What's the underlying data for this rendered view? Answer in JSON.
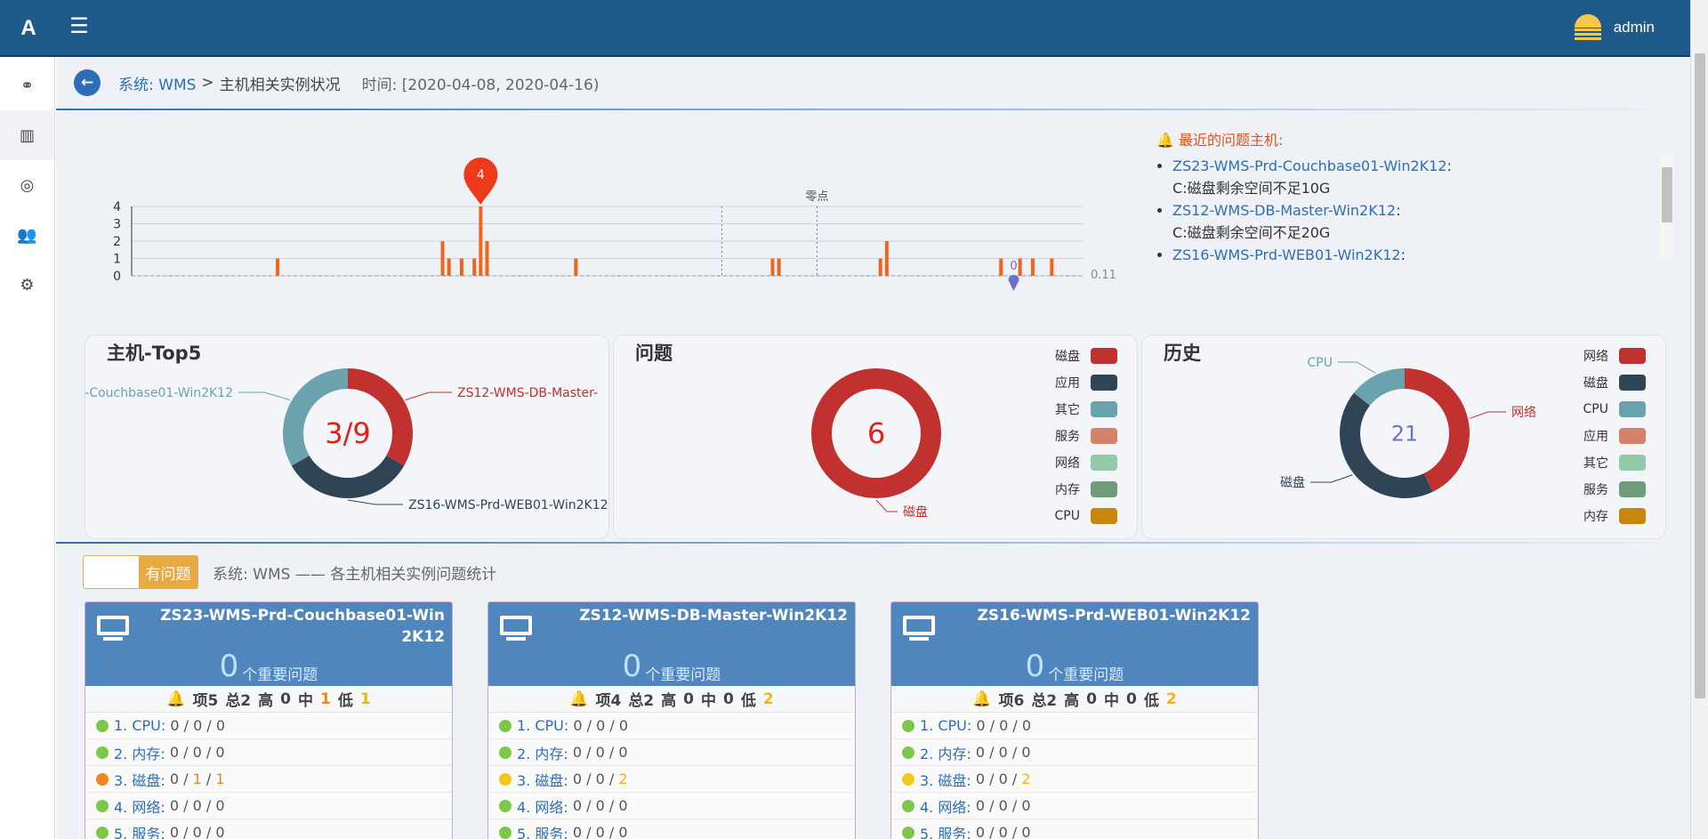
{
  "app": {
    "logo": "A",
    "menu_icon": "hamburger-icon",
    "user": "admin"
  },
  "sidebar": {
    "items": [
      {
        "icon": "link-icon",
        "glyph": "⚭"
      },
      {
        "icon": "bar-chart-icon",
        "glyph": "▥"
      },
      {
        "icon": "lifebuoy-icon",
        "glyph": "◎"
      },
      {
        "icon": "users-icon",
        "glyph": "👥"
      },
      {
        "icon": "gear-icon",
        "glyph": "⚙"
      }
    ]
  },
  "breadcrumb": {
    "system": "系统: WMS",
    "sep": ">",
    "page": "主机相关实例状况",
    "time": "时间: [2020-04-08, 2020-04-16)"
  },
  "chart_data": [
    {
      "type": "bar",
      "x": [
        23,
        49,
        50,
        52,
        54,
        55,
        56,
        70,
        101,
        102,
        118,
        119,
        137,
        140,
        142,
        145
      ],
      "values": [
        1,
        2,
        1,
        1,
        1,
        4,
        2,
        1,
        1,
        1,
        1,
        2,
        1,
        1,
        1,
        1
      ],
      "yticks": [
        0,
        1,
        2,
        3,
        4
      ],
      "ylim": [
        0,
        4
      ],
      "max_marker": "4",
      "min_marker": "0",
      "markline_label": "零点",
      "avg_label": "0.11"
    },
    {
      "type": "pie",
      "title": "主机-Top5",
      "center_text": "3/9",
      "series": [
        {
          "name": "ZS12-WMS-DB-Master-Win2K12",
          "label": "ZS12-WMS-DB-Master-",
          "value": 3,
          "color": "#c0312f"
        },
        {
          "name": "ZS16-WMS-Prd-WEB01-Win2K12",
          "label": "ZS16-WMS-Prd-WEB01-Win2K12",
          "value": 3,
          "color": "#2f4556"
        },
        {
          "name": "ZS23-WMS-Prd-Couchbase01-Win2K12",
          "label": "-Couchbase01-Win2K12",
          "value": 3,
          "color": "#6aa3ae"
        }
      ]
    },
    {
      "type": "pie",
      "title": "问题",
      "center_text": "6",
      "legend": [
        "磁盘",
        "应用",
        "其它",
        "服务",
        "网络",
        "内存",
        "CPU"
      ],
      "series": [
        {
          "name": "磁盘",
          "label": "磁盘",
          "value": 6,
          "color": "#c0312f"
        }
      ]
    },
    {
      "type": "pie",
      "title": "历史",
      "center_text": "21",
      "legend": [
        "网络",
        "磁盘",
        "CPU",
        "应用",
        "其它",
        "服务",
        "内存"
      ],
      "series": [
        {
          "name": "网络",
          "label": "网络",
          "value": 9,
          "color": "#c0312f"
        },
        {
          "name": "磁盘",
          "label": "磁盘",
          "value": 9,
          "color": "#2f4556"
        },
        {
          "name": "CPU",
          "label": "CPU",
          "value": 3,
          "color": "#6aa3ae"
        }
      ]
    }
  ],
  "legend_colors": [
    "#c0312f",
    "#2f4556",
    "#6aa3ae",
    "#d4826a",
    "#93c8ab",
    "#6f9d7c",
    "#c8860c"
  ],
  "alerts": {
    "title": "最近的问题主机:",
    "items": [
      {
        "host": "ZS23-WMS-Prd-Couchbase01-Win2K12",
        "colon": ":",
        "msg": "C:磁盘剩余空间不足10G"
      },
      {
        "host": "ZS12-WMS-DB-Master-Win2K12",
        "colon": ":",
        "msg": "C:磁盘剩余空间不足20G"
      },
      {
        "host": "ZS16-WMS-Prd-WEB01-Win2K12",
        "colon": ":",
        "msg": ""
      }
    ]
  },
  "filter": {
    "toggle_label": "有问题",
    "description": "系统: WMS —— 各主机相关实例问题统计"
  },
  "cards": [
    {
      "name": "ZS23-WMS-Prd-Couchbase01-Win2K12",
      "count": "0",
      "count_label": "个重要问题",
      "summary": {
        "items": "项5",
        "total": "总2",
        "high_l": "高",
        "high": "0",
        "mid_l": "中",
        "mid": "1",
        "low_l": "低",
        "low": "1"
      },
      "rows": [
        {
          "label": "1. CPU:",
          "v": [
            "0",
            "0",
            "0"
          ],
          "dot": "#7cc84a"
        },
        {
          "label": "2. 内存:",
          "v": [
            "0",
            "0",
            "0"
          ],
          "dot": "#7cc84a"
        },
        {
          "label": "3. 磁盘:",
          "v": [
            "0",
            "1",
            "1"
          ],
          "dot": "#f0861f"
        },
        {
          "label": "4. 网络:",
          "v": [
            "0",
            "0",
            "0"
          ],
          "dot": "#7cc84a"
        },
        {
          "label": "5. 服务:",
          "v": [
            "0",
            "0",
            "0"
          ],
          "dot": "#7cc84a"
        }
      ]
    },
    {
      "name": "ZS12-WMS-DB-Master-Win2K12",
      "count": "0",
      "count_label": "个重要问题",
      "summary": {
        "items": "项4",
        "total": "总2",
        "high_l": "高",
        "high": "0",
        "mid_l": "中",
        "mid": "0",
        "low_l": "低",
        "low": "2"
      },
      "rows": [
        {
          "label": "1. CPU:",
          "v": [
            "0",
            "0",
            "0"
          ],
          "dot": "#7cc84a"
        },
        {
          "label": "2. 内存:",
          "v": [
            "0",
            "0",
            "0"
          ],
          "dot": "#7cc84a"
        },
        {
          "label": "3. 磁盘:",
          "v": [
            "0",
            "0",
            "2"
          ],
          "dot": "#f2c81a"
        },
        {
          "label": "4. 网络:",
          "v": [
            "0",
            "0",
            "0"
          ],
          "dot": "#7cc84a"
        },
        {
          "label": "5. 服务:",
          "v": [
            "0",
            "0",
            "0"
          ],
          "dot": "#7cc84a"
        }
      ]
    },
    {
      "name": "ZS16-WMS-Prd-WEB01-Win2K12",
      "count": "0",
      "count_label": "个重要问题",
      "summary": {
        "items": "项6",
        "total": "总2",
        "high_l": "高",
        "high": "0",
        "mid_l": "中",
        "mid": "0",
        "low_l": "低",
        "low": "2"
      },
      "rows": [
        {
          "label": "1. CPU:",
          "v": [
            "0",
            "0",
            "0"
          ],
          "dot": "#7cc84a"
        },
        {
          "label": "2. 内存:",
          "v": [
            "0",
            "0",
            "0"
          ],
          "dot": "#7cc84a"
        },
        {
          "label": "3. 磁盘:",
          "v": [
            "0",
            "0",
            "2"
          ],
          "dot": "#f2c81a"
        },
        {
          "label": "4. 网络:",
          "v": [
            "0",
            "0",
            "0"
          ],
          "dot": "#7cc84a"
        },
        {
          "label": "5. 服务:",
          "v": [
            "0",
            "0",
            "0"
          ],
          "dot": "#7cc84a"
        }
      ]
    }
  ]
}
